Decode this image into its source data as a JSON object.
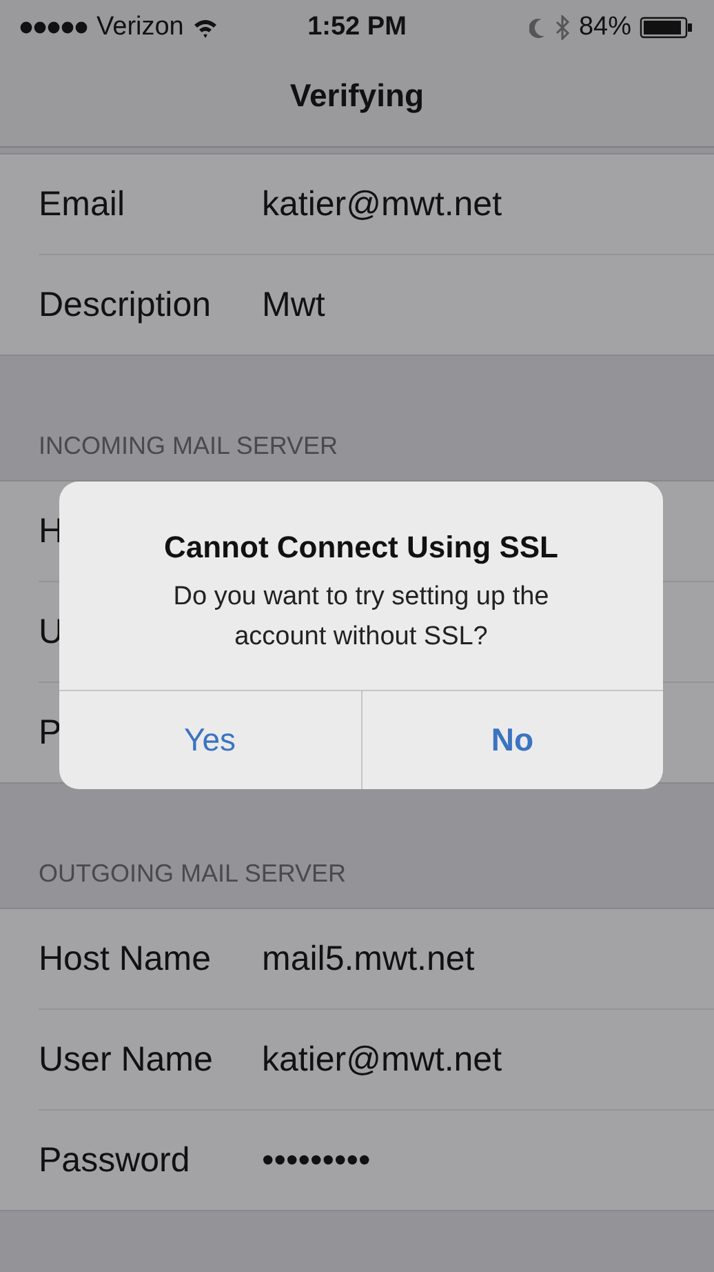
{
  "status_bar": {
    "carrier": "Verizon",
    "time": "1:52 PM",
    "battery": "84%"
  },
  "nav": {
    "title": "Verifying"
  },
  "sections": [
    {
      "rows": [
        {
          "label": "Email",
          "value": "katier@mwt.net"
        },
        {
          "label": "Description",
          "value": "Mwt"
        }
      ]
    },
    {
      "header": "INCOMING MAIL SERVER",
      "rows": [
        {
          "label": "H"
        },
        {
          "label": "U"
        },
        {
          "label": "P"
        }
      ]
    },
    {
      "header": "OUTGOING MAIL SERVER",
      "rows": [
        {
          "label": "Host Name",
          "value": "mail5.mwt.net"
        },
        {
          "label": "User Name",
          "value": "katier@mwt.net"
        },
        {
          "label": "Password",
          "value": "•••••••••"
        }
      ]
    }
  ],
  "alert": {
    "title": "Cannot Connect Using SSL",
    "message": "Do you want to try setting up the account without SSL?",
    "buttons": [
      {
        "label": "Yes",
        "preferred": false
      },
      {
        "label": "No",
        "preferred": true
      }
    ]
  }
}
